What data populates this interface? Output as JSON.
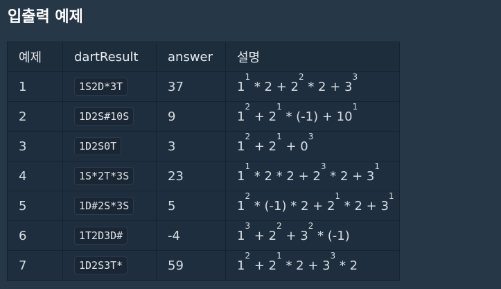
{
  "section": {
    "title": "입출력 예제"
  },
  "table": {
    "headers": [
      "예제",
      "dartResult",
      "answer",
      "설명"
    ],
    "rows": [
      {
        "no": "1",
        "dartResult": "1S2D*3T",
        "answer": "37",
        "explanation": [
          {
            "t": "1"
          },
          {
            "s": "1"
          },
          {
            "t": " * 2 + 2"
          },
          {
            "s": "2"
          },
          {
            "t": " * 2 + 3"
          },
          {
            "s": "3"
          }
        ]
      },
      {
        "no": "2",
        "dartResult": "1D2S#10S",
        "answer": "9",
        "explanation": [
          {
            "t": "1"
          },
          {
            "s": "2"
          },
          {
            "t": " + 2"
          },
          {
            "s": "1"
          },
          {
            "t": " * (-1) + 10"
          },
          {
            "s": "1"
          }
        ]
      },
      {
        "no": "3",
        "dartResult": "1D2S0T",
        "answer": "3",
        "explanation": [
          {
            "t": "1"
          },
          {
            "s": "2"
          },
          {
            "t": " + 2"
          },
          {
            "s": "1"
          },
          {
            "t": " + 0"
          },
          {
            "s": "3"
          }
        ]
      },
      {
        "no": "4",
        "dartResult": "1S*2T*3S",
        "answer": "23",
        "explanation": [
          {
            "t": "1"
          },
          {
            "s": "1"
          },
          {
            "t": " * 2 * 2 + 2"
          },
          {
            "s": "3"
          },
          {
            "t": " * 2 + 3"
          },
          {
            "s": "1"
          }
        ]
      },
      {
        "no": "5",
        "dartResult": "1D#2S*3S",
        "answer": "5",
        "explanation": [
          {
            "t": "1"
          },
          {
            "s": "2"
          },
          {
            "t": " * (-1) * 2 + 2"
          },
          {
            "s": "1"
          },
          {
            "t": " * 2 + 3"
          },
          {
            "s": "1"
          }
        ]
      },
      {
        "no": "6",
        "dartResult": "1T2D3D#",
        "answer": "-4",
        "explanation": [
          {
            "t": "1"
          },
          {
            "s": "3"
          },
          {
            "t": " + 2"
          },
          {
            "s": "2"
          },
          {
            "t": " + 3"
          },
          {
            "s": "2"
          },
          {
            "t": " * (-1)"
          }
        ]
      },
      {
        "no": "7",
        "dartResult": "1D2S3T*",
        "answer": "59",
        "explanation": [
          {
            "t": "1"
          },
          {
            "s": "2"
          },
          {
            "t": " + 2"
          },
          {
            "s": "1"
          },
          {
            "t": " * 2 + 3"
          },
          {
            "s": "3"
          },
          {
            "t": " * 2"
          }
        ]
      }
    ]
  }
}
